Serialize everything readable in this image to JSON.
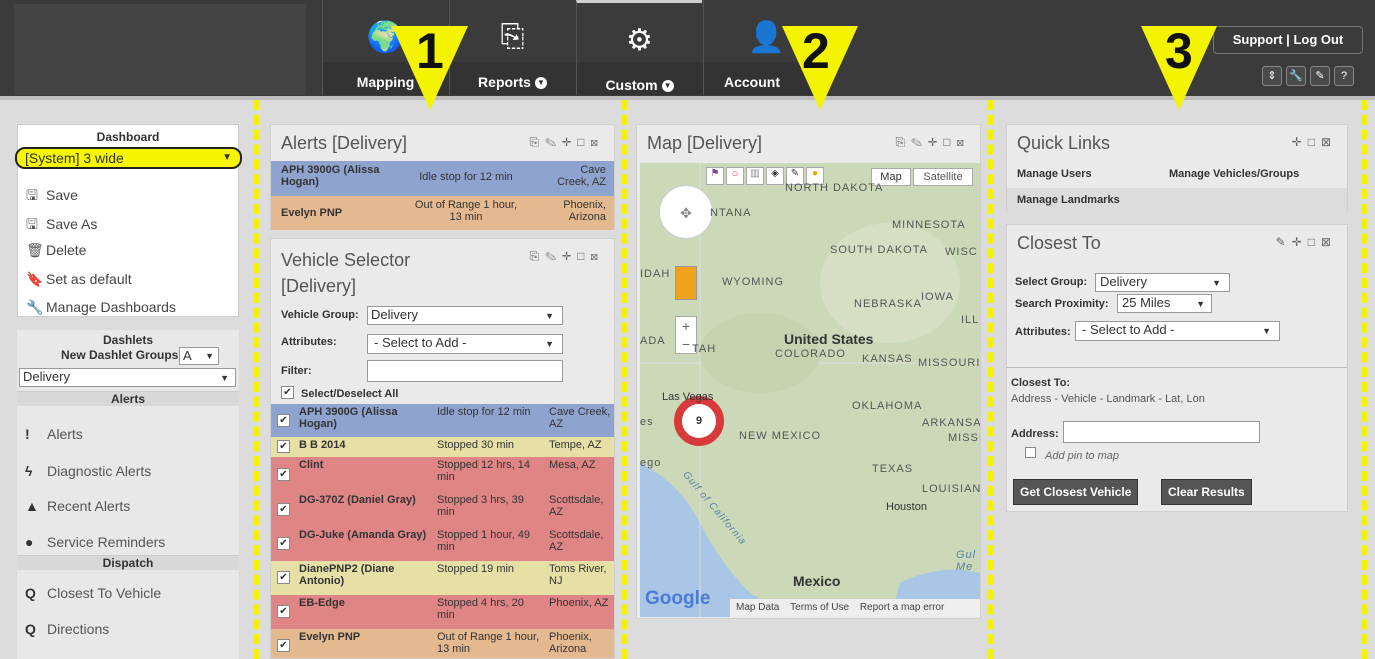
{
  "nav": {
    "items": [
      {
        "label": "Mapping"
      },
      {
        "label": "Reports"
      },
      {
        "label": "Custom"
      },
      {
        "label": "Account"
      }
    ],
    "support": "Support",
    "sep": "|",
    "logout": "Log Out",
    "tool_icons": [
      "⇕",
      "🔧",
      "✎",
      "?"
    ]
  },
  "callouts": [
    "1",
    "2",
    "3"
  ],
  "dashboard": {
    "title": "Dashboard",
    "selected": "[System] 3 wide",
    "menu": [
      {
        "icon": "save",
        "label": "Save"
      },
      {
        "icon": "save",
        "label": "Save As"
      },
      {
        "icon": "trash",
        "label": "Delete"
      },
      {
        "icon": "bookmark",
        "label": "Set as default"
      },
      {
        "icon": "wrench",
        "label": "Manage Dashboards"
      }
    ]
  },
  "dashlets": {
    "title": "Dashlets",
    "groups_label": "New Dashlet Groups:",
    "groups_value": "A",
    "group_select": "Delivery",
    "alerts_head": "Alerts",
    "alerts": [
      "Alerts",
      "Diagnostic Alerts",
      "Recent Alerts",
      "Service Reminders"
    ],
    "dispatch_head": "Dispatch",
    "dispatch": [
      "Closest To Vehicle",
      "Directions"
    ]
  },
  "alerts_card": {
    "title": "Alerts  [Delivery]",
    "rows": [
      {
        "name": "APH 3900G (Alissa Hogan)",
        "status": "Idle stop for 12 min",
        "location": "Cave Creek, AZ",
        "color": "#8ea4cf"
      },
      {
        "name": "Evelyn PNP",
        "status": "Out of Range 1 hour, 13 min",
        "location": "Phoenix, Arizona",
        "color": "#e5b98f"
      }
    ]
  },
  "vehicle_card": {
    "title": "Vehicle Selector [Delivery]",
    "group_label": "Vehicle Group:",
    "group_value": "Delivery",
    "attr_label": "Attributes:",
    "attr_value": "- Select to Add -",
    "filter_label": "Filter:",
    "select_all": "Select/Deselect All",
    "rows": [
      {
        "name": "APH 3900G (Alissa Hogan)",
        "status": "Idle stop for 12 min",
        "location": "Cave Creek, AZ",
        "color": "#8ea4cf"
      },
      {
        "name": "B B 2014",
        "status": "Stopped 30 min",
        "location": "Tempe, AZ",
        "color": "#e6e0a6"
      },
      {
        "name": "Clint",
        "status": "Stopped 12 hrs, 14 min",
        "location": "Mesa, AZ",
        "color": "#e08585"
      },
      {
        "name": "DG-370Z (Daniel Gray)",
        "status": "Stopped 3 hrs, 39 min",
        "location": "Scottsdale, AZ",
        "color": "#e08585"
      },
      {
        "name": "DG-Juke (Amanda Gray)",
        "status": "Stopped 1 hour, 49 min",
        "location": "Scottsdale, AZ",
        "color": "#e08585"
      },
      {
        "name": "DianePNP2 (Diane Antonio)",
        "status": "Stopped 19 min",
        "location": "Toms River, NJ",
        "color": "#e6e0a6"
      },
      {
        "name": "EB-Edge",
        "status": "Stopped 4 hrs, 20 min",
        "location": "Phoenix, AZ",
        "color": "#e08585"
      },
      {
        "name": "Evelyn PNP",
        "status": "Out of Range 1 hour, 13 min",
        "location": "Phoenix, Arizona",
        "color": "#e5b98f"
      }
    ]
  },
  "map_card": {
    "title": "Map  [Delivery]",
    "map_btn": "Map",
    "sat_btn": "Satellite",
    "cluster": "9",
    "labels": [
      "NORTH DAKOTA",
      "MINNESOTA",
      "SOUTH DAKOTA",
      "WISC",
      "WYOMING",
      "IDAH",
      "NEBRASKA",
      "IOWA",
      "ILL",
      "United States",
      "ADA",
      "TAH",
      "COLORADO",
      "KANSAS",
      "MISSOURI",
      "Las Vegas",
      "OKLAHOMA",
      "ARKANSAS",
      "MISSI",
      "NEW MEXICO",
      "TEXAS",
      "LOUISIAN",
      "Houston",
      "Mexico",
      "Gulf of California",
      "Gul Me",
      "ego",
      "es",
      "NTANA"
    ],
    "footer": [
      "Map Data",
      "Terms of Use",
      "Report a map error"
    ],
    "google": "Google"
  },
  "quick_links": {
    "title": "Quick Links",
    "links": [
      "Manage Users",
      "Manage Vehicles/Groups",
      "Manage Landmarks"
    ]
  },
  "closest": {
    "title": "Closest To",
    "group_label": "Select Group:",
    "group_value": "Delivery",
    "prox_label": "Search Proximity:",
    "prox_value": "25 Miles",
    "attr_label": "Attributes:",
    "attr_value": "- Select to Add -",
    "to_label": "Closest To:",
    "to_options": "Address - Vehicle - Landmark - Lat, Lon",
    "address_label": "Address:",
    "pin_label": "Add pin to map",
    "get_btn": "Get Closest Vehicle",
    "clear_btn": "Clear Results"
  }
}
